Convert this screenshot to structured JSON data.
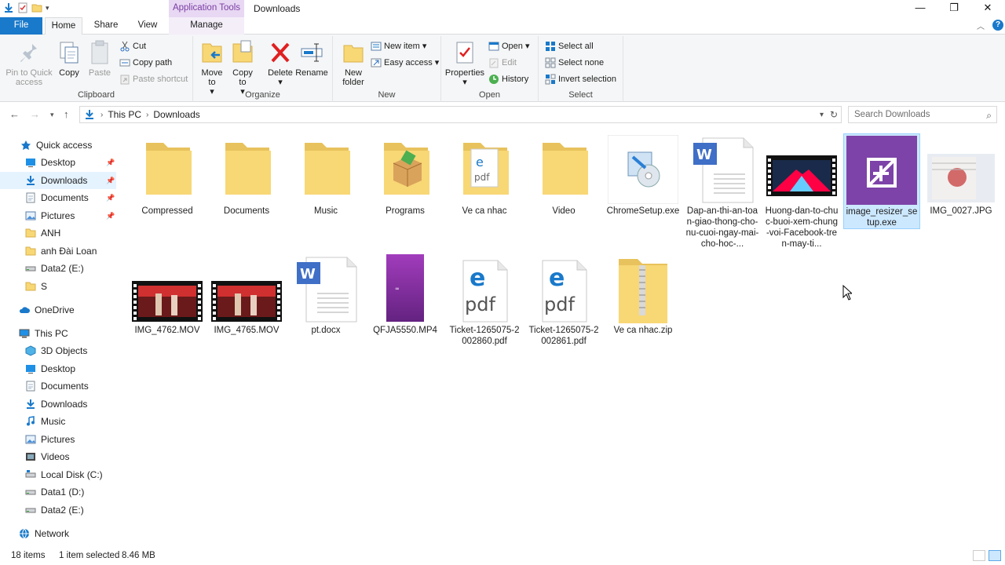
{
  "titlebar": {
    "context_tab": "Application Tools",
    "title": "Downloads",
    "minimize": "—",
    "restore": "❐",
    "close": "✕"
  },
  "tabs": {
    "file": "File",
    "home": "Home",
    "share": "Share",
    "view": "View",
    "manage": "Manage"
  },
  "ribbon": {
    "clipboard": {
      "label": "Clipboard",
      "pin": "Pin to Quick access",
      "copy": "Copy",
      "paste": "Paste",
      "cut": "Cut",
      "copy_path": "Copy path",
      "paste_shortcut": "Paste shortcut"
    },
    "organize": {
      "label": "Organize",
      "move_to": "Move to",
      "copy_to": "Copy to",
      "delete": "Delete",
      "rename": "Rename"
    },
    "new": {
      "label": "New",
      "new_folder": "New folder",
      "new_item": "New item",
      "easy_access": "Easy access"
    },
    "open": {
      "label": "Open",
      "properties": "Properties",
      "open": "Open",
      "edit": "Edit",
      "history": "History"
    },
    "select": {
      "label": "Select",
      "select_all": "Select all",
      "select_none": "Select none",
      "invert": "Invert selection"
    }
  },
  "address": {
    "this_pc": "This PC",
    "downloads": "Downloads",
    "search_placeholder": "Search Downloads"
  },
  "nav": {
    "quick_access": "Quick access",
    "qa_items": [
      "Desktop",
      "Downloads",
      "Documents",
      "Pictures",
      "ANH",
      "anh Đài Loan",
      "Data2 (E:)",
      "S"
    ],
    "onedrive": "OneDrive",
    "this_pc": "This PC",
    "pc_items": [
      "3D Objects",
      "Desktop",
      "Documents",
      "Downloads",
      "Music",
      "Pictures",
      "Videos",
      "Local Disk (C:)",
      "Data1 (D:)",
      "Data2 (E:)"
    ],
    "network": "Network"
  },
  "files": [
    {
      "name": "Compressed",
      "kind": "folder"
    },
    {
      "name": "Documents",
      "kind": "folder"
    },
    {
      "name": "Music",
      "kind": "folder"
    },
    {
      "name": "Programs",
      "kind": "folder-box"
    },
    {
      "name": "Ve ca nhac",
      "kind": "folder-pdf"
    },
    {
      "name": "Video",
      "kind": "folder"
    },
    {
      "name": "ChromeSetup.exe",
      "kind": "setup"
    },
    {
      "name": "Dap-an-thi-an-toan-giao-thong-cho-nu-cuoi-ngay-mai-cho-hoc-...",
      "kind": "word"
    },
    {
      "name": "Huong-dan-to-chuc-buoi-xem-chung-voi-Facebook-tren-may-ti...",
      "kind": "video-dark"
    },
    {
      "name": "image_resizer_setup.exe",
      "kind": "resizer"
    },
    {
      "name": "IMG_0027.JPG",
      "kind": "photo"
    },
    {
      "name": "IMG_4762.MOV",
      "kind": "video-red"
    },
    {
      "name": "IMG_4765.MOV",
      "kind": "video-red"
    },
    {
      "name": "pt.docx",
      "kind": "word"
    },
    {
      "name": "QFJA5550.MP4",
      "kind": "mp4"
    },
    {
      "name": "Ticket-1265075-2002860.pdf",
      "kind": "pdf"
    },
    {
      "name": "Ticket-1265075-2002861.pdf",
      "kind": "pdf"
    },
    {
      "name": "Ve ca nhac.zip",
      "kind": "zip"
    }
  ],
  "status": {
    "count": "18 items",
    "selected": "1 item selected",
    "size": "8.46 MB"
  },
  "colors": {
    "accent": "#1979ca",
    "selection": "#cce8ff",
    "folder": "#f8d775"
  }
}
